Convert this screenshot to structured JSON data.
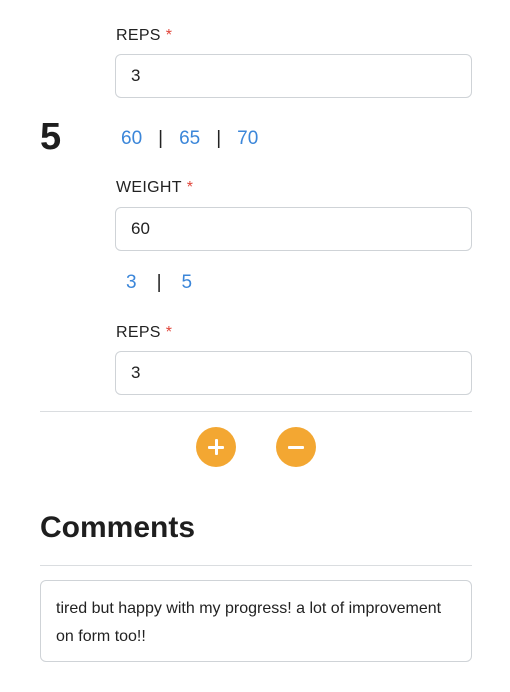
{
  "set_top": {
    "reps_label": "REPS",
    "required_mark": "*",
    "reps_value": "3"
  },
  "set": {
    "number": "5",
    "weight_quick_options": [
      "60",
      "65",
      "70"
    ],
    "weight_label": "WEIGHT",
    "weight_value": "60",
    "reps_quick_options": [
      "3",
      "5"
    ],
    "reps_label": "REPS",
    "reps_value": "3"
  },
  "separator": "|",
  "actions": {
    "add_icon": "plus-icon",
    "remove_icon": "minus-icon",
    "button_color": "#f3a732"
  },
  "comments": {
    "title": "Comments",
    "text": "tired but happy with my progress! a lot of improvement on form too!!"
  },
  "colors": {
    "link": "#3b86d9",
    "required": "#e0453a"
  }
}
